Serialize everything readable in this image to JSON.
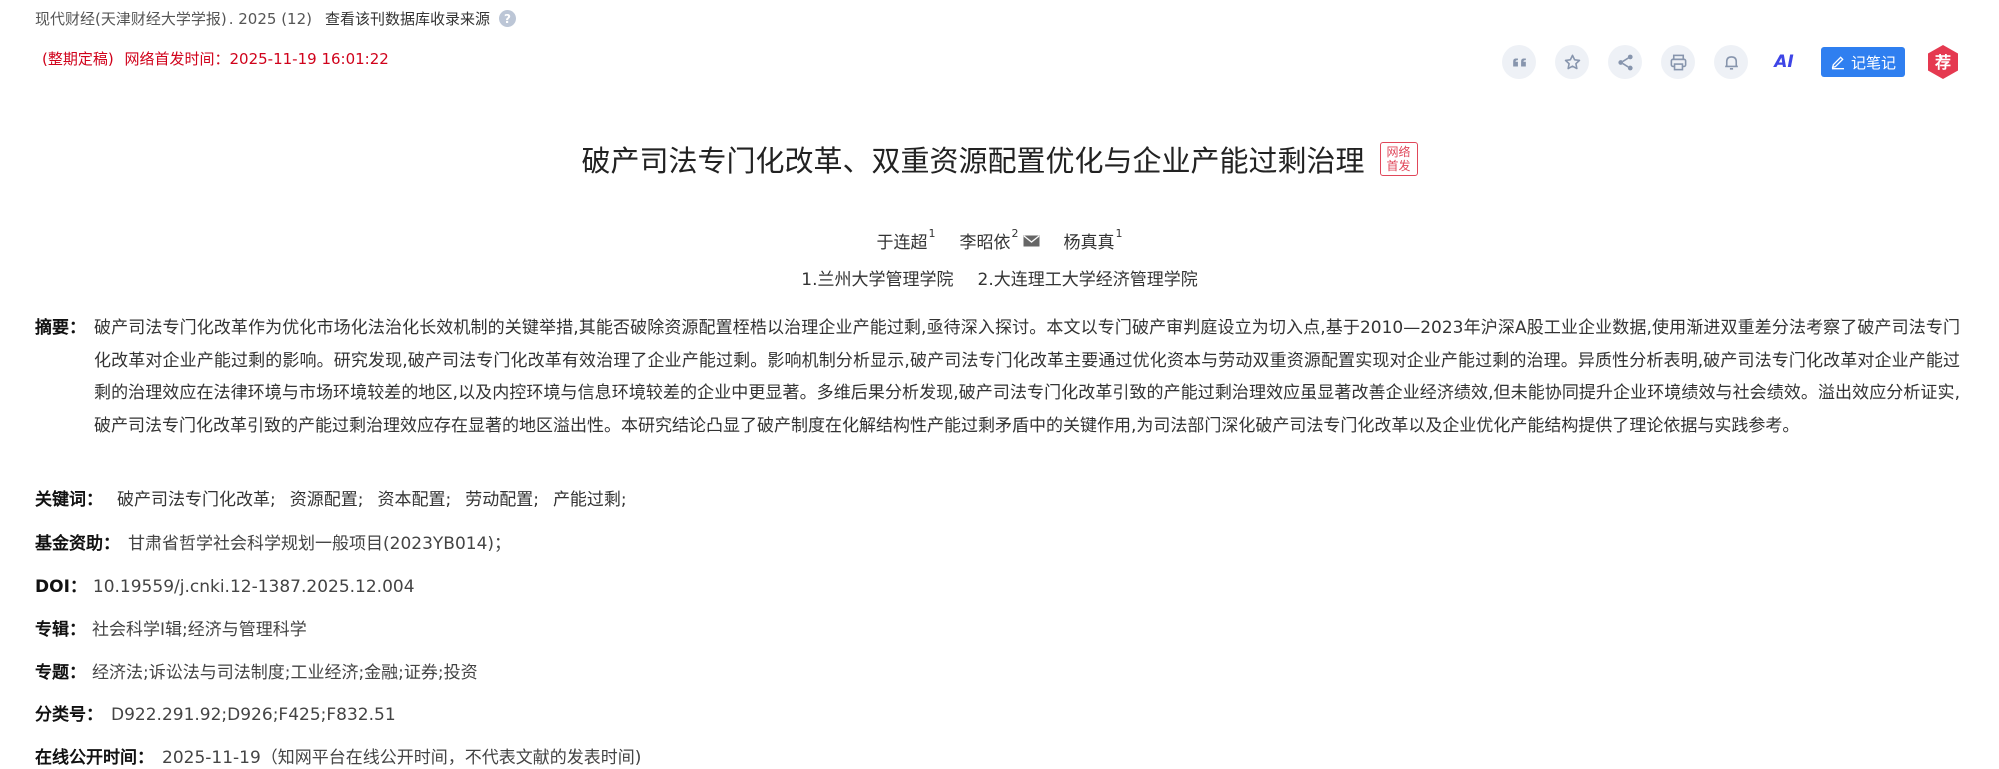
{
  "header": {
    "source": "现代财经(天津财经大学学报)",
    "issue": ". 2025 (12)",
    "db_link": "查看该刊数据库收录来源",
    "help_symbol": "?",
    "status": "(整期定稿)",
    "pub_label": "网络首发时间：2025-11-19 16:01:22"
  },
  "toolbar": {
    "ai_label": "AI",
    "note_label": "记笔记",
    "rec_label": "荐"
  },
  "paper": {
    "title": "破产司法专门化改革、双重资源配置优化与企业产能过剩治理",
    "badge_line1": "网络",
    "badge_line2": "首发",
    "authors": [
      {
        "name": "于连超",
        "sup": "1"
      },
      {
        "name": "李昭依",
        "sup": "2"
      },
      {
        "name": "杨真真",
        "sup": "1"
      }
    ],
    "orgs": [
      "1.兰州大学管理学院",
      "2.大连理工大学经济管理学院"
    ],
    "abstract_label": "摘要：",
    "abstract": "破产司法专门化改革作为优化市场化法治化长效机制的关键举措,其能否破除资源配置桎梏以治理企业产能过剩,亟待深入探讨。本文以专门破产审判庭设立为切入点,基于2010—2023年沪深A股工业企业数据,使用渐进双重差分法考察了破产司法专门化改革对企业产能过剩的影响。研究发现,破产司法专门化改革有效治理了企业产能过剩。影响机制分析显示,破产司法专门化改革主要通过优化资本与劳动双重资源配置实现对企业产能过剩的治理。异质性分析表明,破产司法专门化改革对企业产能过剩的治理效应在法律环境与市场环境较差的地区,以及内控环境与信息环境较差的企业中更显著。多维后果分析发现,破产司法专门化改革引致的产能过剩治理效应虽显著改善企业经济绩效,但未能协同提升企业环境绩效与社会绩效。溢出效应分析证实,破产司法专门化改革引致的产能过剩治理效应存在显著的地区溢出性。本研究结论凸显了破产制度在化解结构性产能过剩矛盾中的关键作用,为司法部门深化破产司法专门化改革以及企业优化产能结构提供了理论依据与实践参考。",
    "keywords_label": "关键词：",
    "keywords": [
      "破产司法专门化改革;",
      "资源配置;",
      "资本配置;",
      "劳动配置;",
      "产能过剩;"
    ],
    "fund_label": "基金资助：",
    "fund": "甘肃省哲学社会科学规划一般项目(2023YB014)；",
    "doi_label": "DOI：",
    "doi": "10.19559/j.cnki.12-1387.2025.12.004",
    "series_label": "专辑：",
    "series": "社会科学Ⅰ辑;经济与管理科学",
    "topic_label": "专题：",
    "topic": "经济法;诉讼法与司法制度;工业经济;金融;证券;投资",
    "clc_label": "分类号：",
    "clc": "D922.291.92;D926;F425;F832.51",
    "online_label": "在线公开时间：",
    "online": "2025-11-19（知网平台在线公开时间，不代表文献的发表时间)"
  },
  "colors": {
    "accent_blue": "#2f7ff0",
    "status_red": "#d0021b",
    "ai_purple": "#3e45e6",
    "rec_red": "#e53950"
  }
}
